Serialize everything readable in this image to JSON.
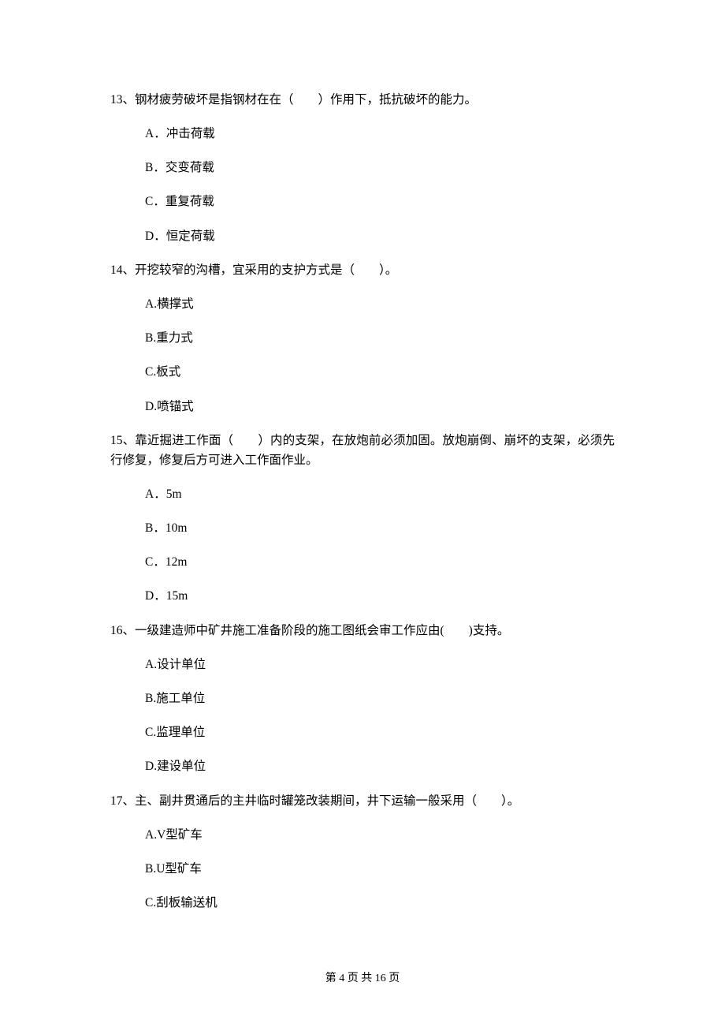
{
  "questions": [
    {
      "number": "13、",
      "text": "钢材疲劳破坏是指钢材在在（　　）作用下，抵抗破坏的能力。",
      "options": [
        "A．冲击荷载",
        "B．交变荷载",
        "C．重复荷载",
        "D．恒定荷载"
      ]
    },
    {
      "number": "14、",
      "text": "开挖较窄的沟槽，宜采用的支护方式是（　　）。",
      "options": [
        "A.横撑式",
        "B.重力式",
        "C.板式",
        "D.喷锚式"
      ]
    },
    {
      "number": "15、",
      "text": "靠近掘进工作面（　　）内的支架，在放炮前必须加固。放炮崩倒、崩坏的支架，必须先行修复，修复后方可进入工作面作业。",
      "options": [
        "A．5m",
        "B．10m",
        "C．12m",
        "D．15m"
      ]
    },
    {
      "number": "16、",
      "text": "一级建造师中矿井施工准备阶段的施工图纸会审工作应由(　　)支持。",
      "options": [
        "A.设计单位",
        "B.施工单位",
        "C.监理单位",
        "D.建设单位"
      ]
    },
    {
      "number": "17、",
      "text": "主、副井贯通后的主井临时罐笼改装期间，井下运输一般采用（　　）。",
      "options": [
        "A.V型矿车",
        "B.U型矿车",
        "C.刮板输送机"
      ]
    }
  ],
  "footer": "第 4 页 共 16 页"
}
